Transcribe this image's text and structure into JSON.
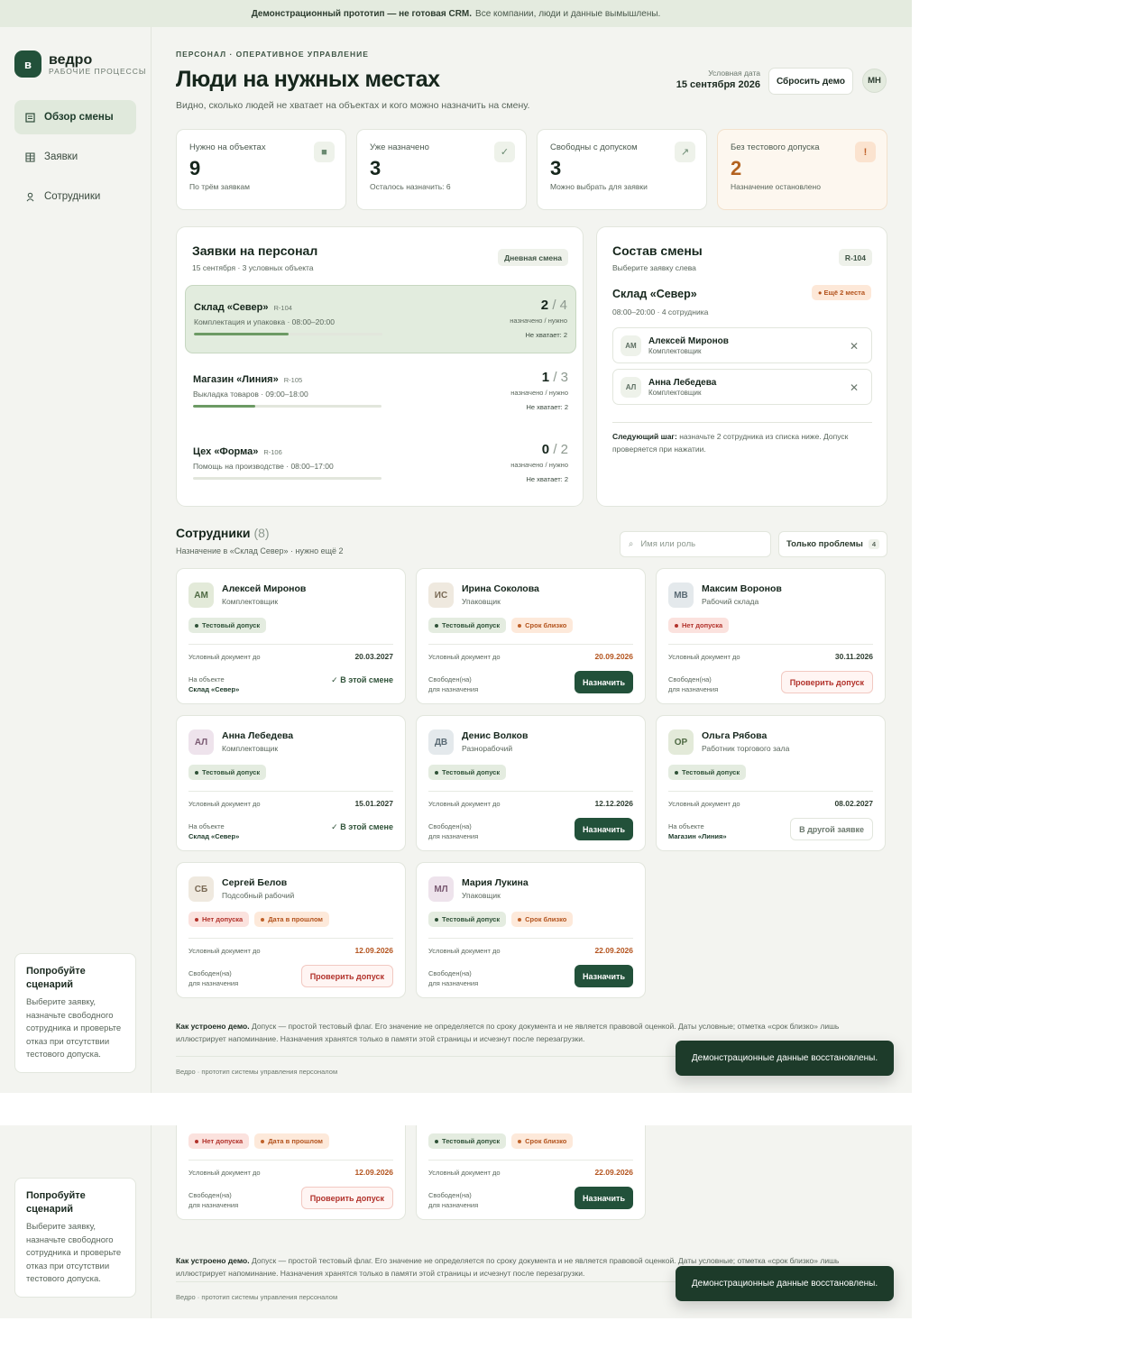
{
  "banner": {
    "strong": "Демонстрационный прототип — не готовая CRM.",
    "rest": "Все компании, люди и данные вымышлены."
  },
  "brand": {
    "mark": "в",
    "name": "ведро",
    "tagline": "РАБОЧИЕ ПРОЦЕССЫ"
  },
  "nav": [
    {
      "label": "Обзор смены",
      "icon": "list-icon",
      "active": true
    },
    {
      "label": "Заявки",
      "icon": "grid-icon",
      "active": false
    },
    {
      "label": "Сотрудники",
      "icon": "person-icon",
      "active": false
    }
  ],
  "try": {
    "title": "Попробуйте сценарий",
    "text": "Выберите заявку, назначьте свободного сотрудника и проверьте отказ при отсутствии тестового допуска."
  },
  "header": {
    "eyebrow": "ПЕРСОНАЛ · ОПЕРАТИВНОЕ УПРАВЛЕНИЕ",
    "title": "Люди на нужных местах",
    "subtitle": "Видно, сколько людей не хватает на объектах и кого можно назначить на смену.",
    "date_label": "Условная дата",
    "date_value": "15 сентября 2026",
    "reset_label": "Сбросить демо",
    "user_initials": "МН"
  },
  "stats": [
    {
      "label": "Нужно на объектах",
      "value": "9",
      "note": "По трём заявкам",
      "icon": "■"
    },
    {
      "label": "Уже назначено",
      "value": "3",
      "note": "Осталось назначить: 6",
      "icon": "✓"
    },
    {
      "label": "Свободны с допуском",
      "value": "3",
      "note": "Можно выбрать для заявки",
      "icon": "↗"
    },
    {
      "label": "Без тестового допуска",
      "value": "2",
      "note": "Назначение остановлено",
      "icon": "!"
    }
  ],
  "orders": {
    "title": "Заявки на персонал",
    "sub": "15 сентября · 3 условных объекта",
    "pill": "Дневная смена",
    "items": [
      {
        "name": "Склад «Север»",
        "code": "R-104",
        "desc": "Комплектация и упаковка · 08:00–20:00",
        "assigned": "2",
        "total": "/ 4",
        "count_label": "назначено / нужно",
        "short": "Не хватает: 2",
        "progress": 0.5
      },
      {
        "name": "Магазин «Линия»",
        "code": "R-105",
        "desc": "Выкладка товаров · 09:00–18:00",
        "assigned": "1",
        "total": "/ 3",
        "count_label": "назначено / нужно",
        "short": "Не хватает: 2",
        "progress": 0.33
      },
      {
        "name": "Цех «Форма»",
        "code": "R-106",
        "desc": "Помощь на производстве · 08:00–17:00",
        "assigned": "0",
        "total": "/ 2",
        "count_label": "назначено / нужно",
        "short": "Не хватает: 2",
        "progress": 0
      }
    ]
  },
  "crew": {
    "title": "Состав смены",
    "sub": "Выберите заявку слева",
    "pill": "R-104",
    "object": "Склад «Север»",
    "object_sub": "08:00–20:00 · 4 сотрудника",
    "badge": "● Ещё 2 места",
    "people": [
      {
        "initials": "АМ",
        "name": "Алексей Миронов",
        "role": "Комплектовщик"
      },
      {
        "initials": "АЛ",
        "name": "Анна Лебедева",
        "role": "Комплектовщик"
      }
    ],
    "next_strong": "Следующий шаг:",
    "next_text": "назначьте 2 сотрудника из списка ниже. Допуск проверяется при нажатии."
  },
  "employees": {
    "title": "Сотрудники",
    "count": "(8)",
    "sub": "Назначение в «Склад Север» · нужно ещё 2",
    "search_placeholder": "Имя или роль",
    "filter_label": "Только проблемы",
    "filter_count": "4",
    "doc_label": "Условный документ до",
    "items": [
      {
        "initials": "АМ",
        "name": "Алексей Миронов",
        "role": "Комплектовщик",
        "tags": [
          [
            "ok",
            "Тестовый допуск"
          ]
        ],
        "doc": "20.03.2027",
        "doc_soon": false,
        "status1": "На объекте",
        "status2": "Склад «Север»",
        "status_bold": true,
        "action": "✓ В этой смене",
        "action_type": "inshift",
        "av_bg": "#e3ead9",
        "av_fg": "#4f6a44"
      },
      {
        "initials": "ИС",
        "name": "Ирина Соколова",
        "role": "Упаковщик",
        "tags": [
          [
            "ok",
            "Тестовый допуск"
          ],
          [
            "soon",
            "Срок близко"
          ]
        ],
        "doc": "20.09.2026",
        "doc_soon": true,
        "status1": "Свободен(на)",
        "status2": "для назначения",
        "status_bold": false,
        "action": "Назначить",
        "action_type": "assign",
        "av_bg": "#efe9df",
        "av_fg": "#7a6a55"
      },
      {
        "initials": "МВ",
        "name": "Максим Воронов",
        "role": "Рабочий склада",
        "tags": [
          [
            "bad",
            "Нет допуска"
          ]
        ],
        "doc": "30.11.2026",
        "doc_soon": false,
        "status1": "Свободен(на)",
        "status2": "для назначения",
        "status_bold": false,
        "action": "Проверить допуск",
        "action_type": "check",
        "av_bg": "#e4e9ec",
        "av_fg": "#5a6a74"
      },
      {
        "initials": "АЛ",
        "name": "Анна Лебедева",
        "role": "Комплектовщик",
        "tags": [
          [
            "ok",
            "Тестовый допуск"
          ]
        ],
        "doc": "15.01.2027",
        "doc_soon": false,
        "status1": "На объекте",
        "status2": "Склад «Север»",
        "status_bold": true,
        "action": "✓ В этой смене",
        "action_type": "inshift",
        "av_bg": "#eee3ec",
        "av_fg": "#7a5a72"
      },
      {
        "initials": "ДВ",
        "name": "Денис Волков",
        "role": "Разнорабочий",
        "tags": [
          [
            "ok",
            "Тестовый допуск"
          ]
        ],
        "doc": "12.12.2026",
        "doc_soon": false,
        "status1": "Свободен(на)",
        "status2": "для назначения",
        "status_bold": false,
        "action": "Назначить",
        "action_type": "assign",
        "av_bg": "#e4e9ec",
        "av_fg": "#5a6a74"
      },
      {
        "initials": "ОР",
        "name": "Ольга Рябова",
        "role": "Работник торгового зала",
        "tags": [
          [
            "ok",
            "Тестовый допуск"
          ]
        ],
        "doc": "08.02.2027",
        "doc_soon": false,
        "status1": "На объекте",
        "status2": "Магазин «Линия»",
        "status_bold": true,
        "action": "В другой заявке",
        "action_type": "other",
        "av_bg": "#e3ead9",
        "av_fg": "#4f6a44"
      },
      {
        "initials": "СБ",
        "name": "Сергей Белов",
        "role": "Подсобный рабочий",
        "tags": [
          [
            "bad",
            "Нет допуска"
          ],
          [
            "soon",
            "Дата в прошлом"
          ]
        ],
        "doc": "12.09.2026",
        "doc_soon": true,
        "status1": "Свободен(на)",
        "status2": "для назначения",
        "status_bold": false,
        "action": "Проверить допуск",
        "action_type": "check",
        "av_bg": "#efe9df",
        "av_fg": "#7a6a55"
      },
      {
        "initials": "МЛ",
        "name": "Мария Лукина",
        "role": "Упаковщик",
        "tags": [
          [
            "ok",
            "Тестовый допуск"
          ],
          [
            "soon",
            "Срок близко"
          ]
        ],
        "doc": "22.09.2026",
        "doc_soon": true,
        "status1": "Свободен(на)",
        "status2": "для назначения",
        "status_bold": false,
        "action": "Назначить",
        "action_type": "assign",
        "av_bg": "#eee3ec",
        "av_fg": "#7a5a72"
      }
    ]
  },
  "footnote": {
    "strong": "Как устроено демо.",
    "text": "Допуск — простой тестовый флаг. Его значение не определяется по сроку документа и не является правовой оценкой. Даты условные; отметка «срок близко» лишь иллюстрирует напоминание. Назначения хранятся только в памяти этой страницы и исчезнут после перезагрузки."
  },
  "footer": "Ведро · прототип системы управления персоналом",
  "toast": "Демонстрационные данные восстановлены."
}
